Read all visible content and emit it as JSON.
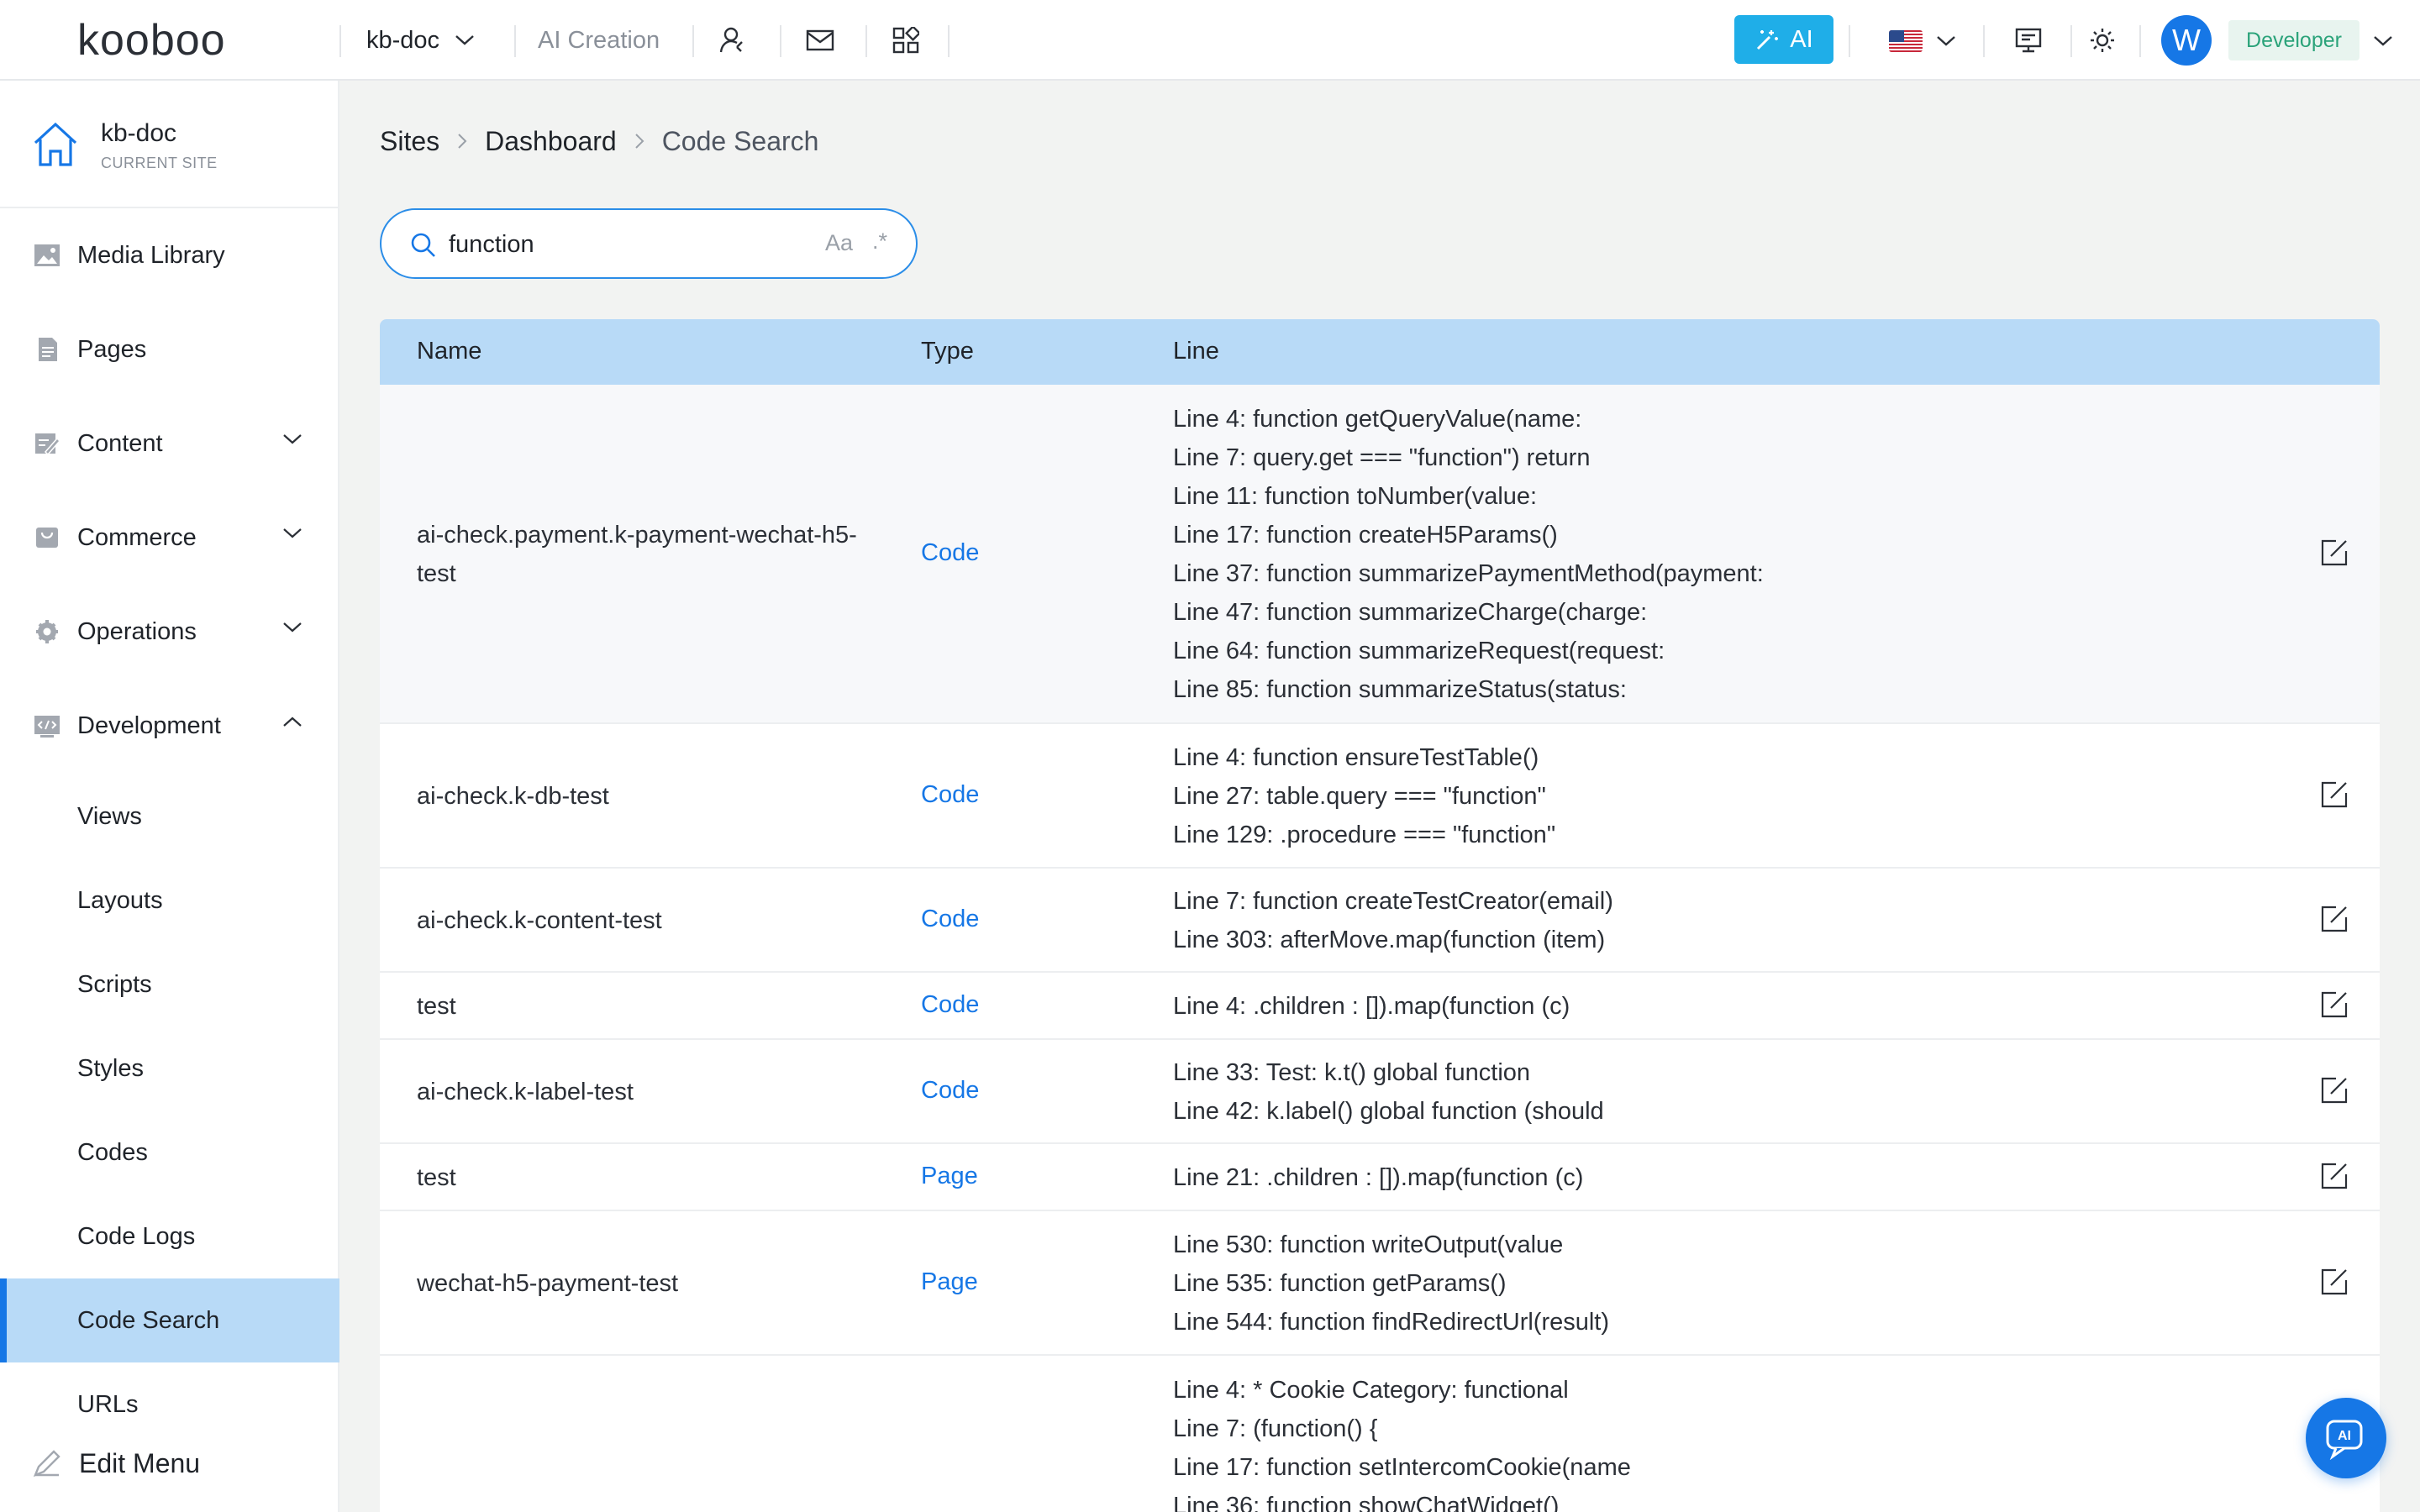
{
  "app": {
    "logo_text": "kooboo"
  },
  "topbar": {
    "site_name": "kb-doc",
    "ai_creation_label": "AI Creation",
    "ai_button_label": "AI",
    "user_initial": "W",
    "role_label": "Developer",
    "icons": [
      "user-switch-icon",
      "mail-icon",
      "apps-icon",
      "monitor-icon",
      "theme-sun-icon"
    ]
  },
  "sidebar": {
    "current_site": {
      "name": "kb-doc",
      "caption": "CURRENT SITE"
    },
    "items": [
      {
        "label": "Media Library",
        "icon": "image-icon",
        "expandable": false
      },
      {
        "label": "Pages",
        "icon": "page-icon",
        "expandable": false
      },
      {
        "label": "Content",
        "icon": "content-icon",
        "expandable": true
      },
      {
        "label": "Commerce",
        "icon": "commerce-icon",
        "expandable": true
      },
      {
        "label": "Operations",
        "icon": "gear-icon",
        "expandable": true
      },
      {
        "label": "Development",
        "icon": "code-icon",
        "expandable": true,
        "expanded": true
      }
    ],
    "development_children": [
      {
        "label": "Views"
      },
      {
        "label": "Layouts"
      },
      {
        "label": "Scripts"
      },
      {
        "label": "Styles"
      },
      {
        "label": "Codes"
      },
      {
        "label": "Code Logs"
      },
      {
        "label": "Code Search",
        "active": true
      },
      {
        "label": "URLs"
      }
    ],
    "edit_menu_label": "Edit Menu"
  },
  "breadcrumb": [
    "Sites",
    "Dashboard",
    "Code Search"
  ],
  "search": {
    "value": "function",
    "match_case_label": "Aa",
    "regex_label": ".*"
  },
  "table": {
    "columns": [
      "Name",
      "Type",
      "Line"
    ],
    "rows": [
      {
        "name": "ai-check.payment.k-payment-wechat-h5-test",
        "type": "Code",
        "lines": [
          "Line 4: function getQueryValue(name:",
          "Line 7: query.get === \"function\") return",
          "Line 11: function toNumber(value:",
          "Line 17: function createH5Params()",
          "Line 37: function summarizePaymentMethod(payment:",
          "Line 47: function summarizeCharge(charge:",
          "Line 64: function summarizeRequest(request:",
          "Line 85: function summarizeStatus(status:"
        ]
      },
      {
        "name": "ai-check.k-db-test",
        "type": "Code",
        "lines": [
          "Line 4: function ensureTestTable()",
          "Line 27: table.query === \"function\"",
          "Line 129: .procedure === \"function\""
        ]
      },
      {
        "name": "ai-check.k-content-test",
        "type": "Code",
        "lines": [
          "Line 7: function createTestCreator(email)",
          "Line 303: afterMove.map(function (item)"
        ]
      },
      {
        "name": "test",
        "type": "Code",
        "lines": [
          "Line 4: .children : []).map(function (c)"
        ]
      },
      {
        "name": "ai-check.k-label-test",
        "type": "Code",
        "lines": [
          "Line 33: Test: k.t() global function",
          "Line 42: k.label() global function (should"
        ]
      },
      {
        "name": "test",
        "type": "Page",
        "lines": [
          "Line 21: .children : []).map(function (c)"
        ]
      },
      {
        "name": "wechat-h5-payment-test",
        "type": "Page",
        "lines": [
          "Line 530: function writeOutput(value",
          "Line 535: function getParams()",
          "Line 544: function findRedirectUrl(result)"
        ]
      },
      {
        "name": "",
        "type": "",
        "lines": [
          "Line 4: * Cookie Category: functional",
          "Line 7: (function() {",
          "Line 17: function setIntercomCookie(name",
          "Line 36: function showChatWidget()"
        ]
      }
    ]
  },
  "colors": {
    "accent": "#1677e6",
    "header_row": "#b8daf7",
    "ai_button": "#1faee8",
    "role_text": "#2ba37a"
  }
}
